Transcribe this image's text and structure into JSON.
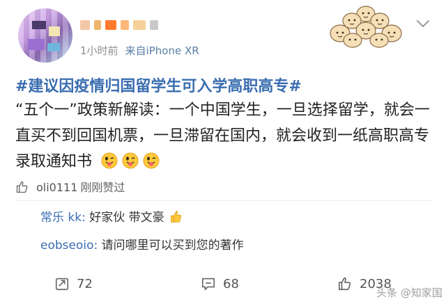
{
  "header": {
    "time": "1小时前",
    "device": "来自iPhone XR"
  },
  "post": {
    "topic": "#建议因疫情归国留学生可入学高职高专#",
    "text": "“五个一”政策新解读：一个中国学生，一旦选择留学，就会一直买不到回国机票，一旦滞留在国内，就会收到一纸高职高专录取通知书"
  },
  "likes": {
    "user": "oli0111",
    "text": "刚刚赞过"
  },
  "comments": [
    {
      "name": "常乐 kk:",
      "text": "好家伙 带文豪"
    },
    {
      "name": "eobseoio:",
      "text": "请问哪里可以买到您的著作"
    }
  ],
  "actions": {
    "repost_count": "72",
    "comment_count": "68",
    "like_count": "2038"
  },
  "watermark": "头条 @知家国",
  "colors": {
    "link_blue": "#3a6db0",
    "meta_gray": "#8f8f8f"
  },
  "icons": [
    "avatar",
    "sticker-group",
    "chevron-down-icon",
    "tongue-emoji-icon",
    "thumb-up-icon",
    "repost-icon",
    "comment-icon"
  ]
}
